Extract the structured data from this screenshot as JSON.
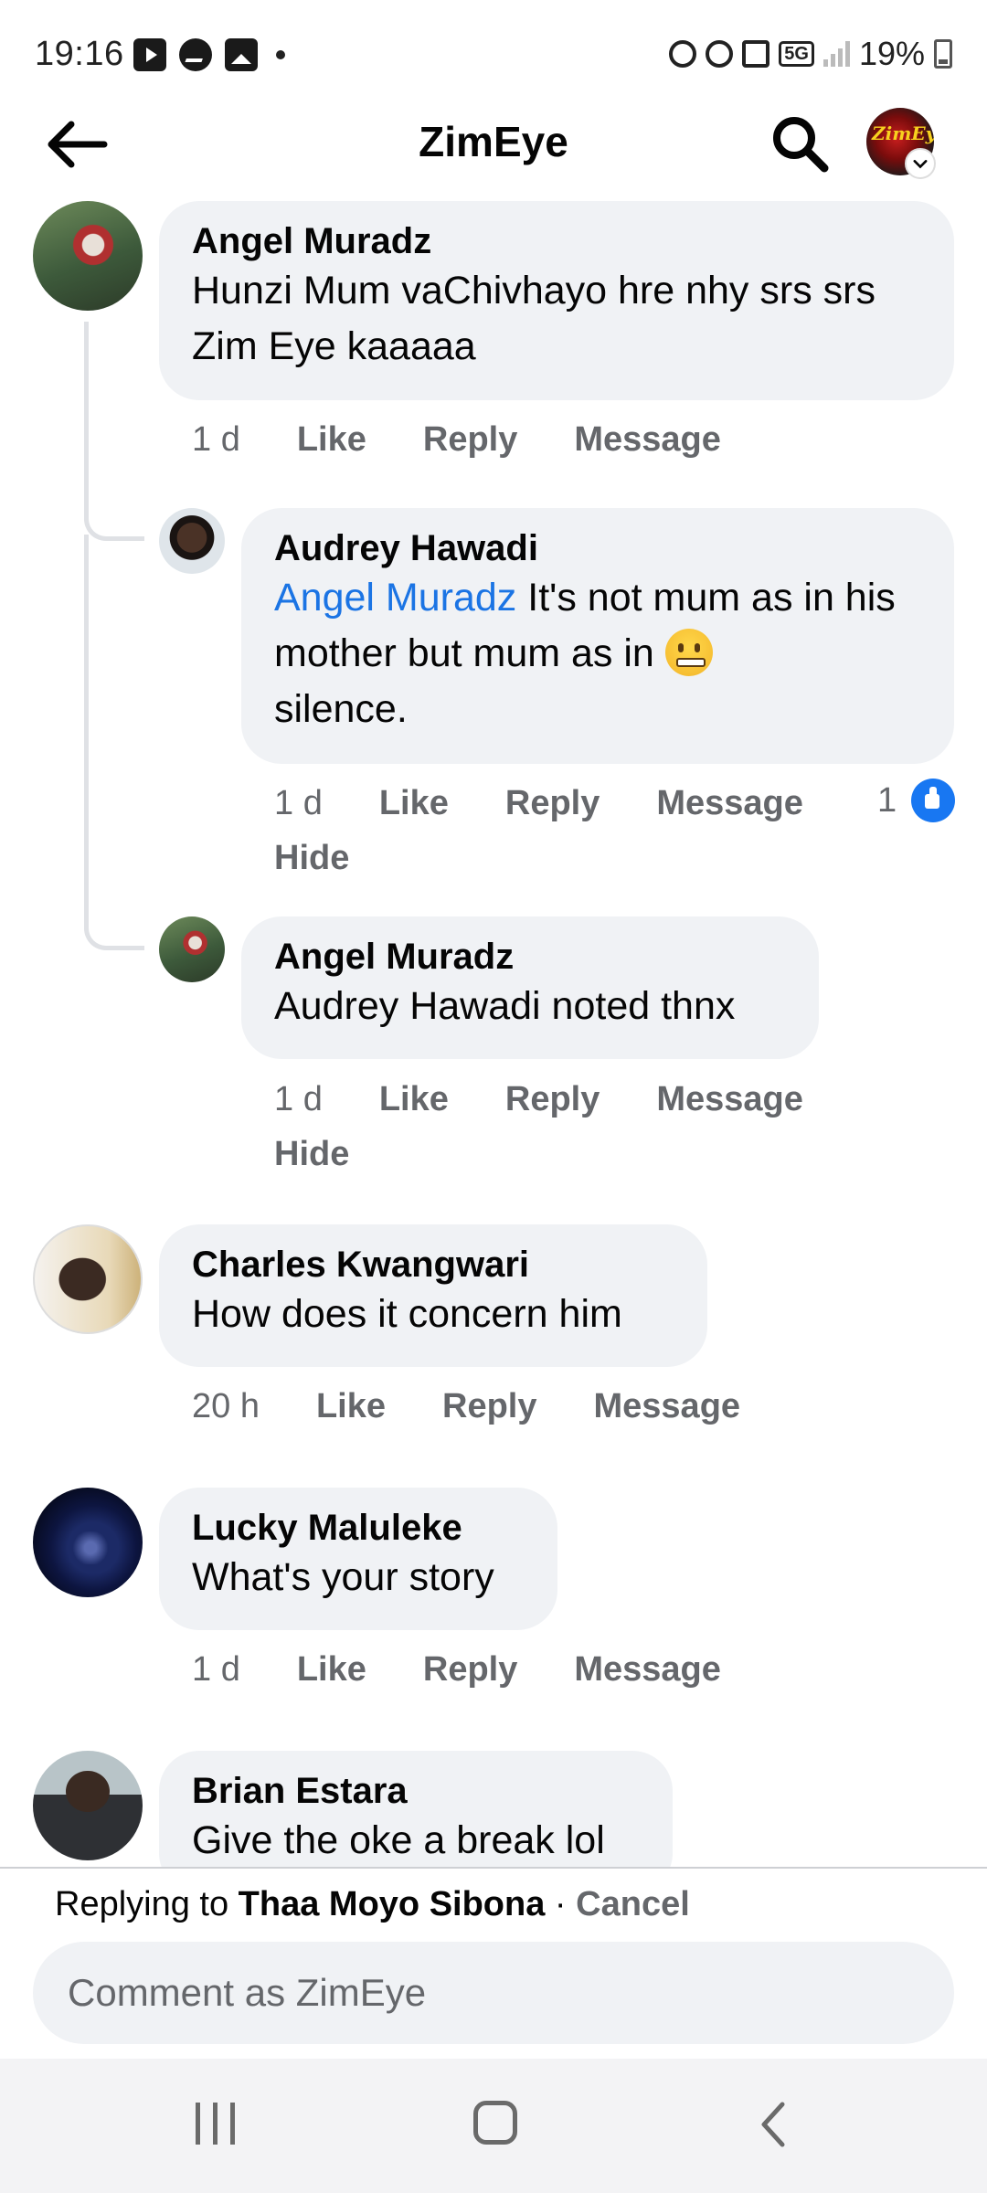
{
  "status_bar": {
    "time": "19:16",
    "battery": "19%",
    "network": "5G"
  },
  "header": {
    "title": "ZimEye",
    "page_avatar_text": "ZimEye"
  },
  "comments": [
    {
      "author": "Angel Muradz",
      "text": "Hunzi Mum vaChivhayo hre nhy srs srs Zim Eye kaaaaa",
      "time": "1 d",
      "like": "Like",
      "reply": "Reply",
      "message": "Message"
    },
    {
      "author": "Audrey Hawadi",
      "mention": "Angel Muradz",
      "text": " It's not mum as in his mother but mum as in ",
      "text_after": "silence.",
      "time": "1 d",
      "like": "Like",
      "reply": "Reply",
      "message": "Message",
      "hide": "Hide",
      "reaction_count": "1"
    },
    {
      "author": "Angel Muradz",
      "text": "Audrey Hawadi noted thnx",
      "time": "1 d",
      "like": "Like",
      "reply": "Reply",
      "message": "Message",
      "hide": "Hide"
    },
    {
      "author": "Charles Kwangwari",
      "text": "How does it concern him",
      "time": "20 h",
      "like": "Like",
      "reply": "Reply",
      "message": "Message"
    },
    {
      "author": "Lucky Maluleke",
      "text": "What's your story",
      "time": "1 d",
      "like": "Like",
      "reply": "Reply",
      "message": "Message"
    },
    {
      "author": "Brian Estara",
      "text": "Give the oke a break lol"
    }
  ],
  "reply_bar": {
    "prefix": "Replying to ",
    "target": "Thaa Moyo Sibona",
    "separator": " · ",
    "cancel": "Cancel",
    "placeholder": "Comment as ZimEye"
  },
  "colors": {
    "accent": "#1b74e4",
    "bubble": "#f0f2f5",
    "muted": "#65676b"
  }
}
